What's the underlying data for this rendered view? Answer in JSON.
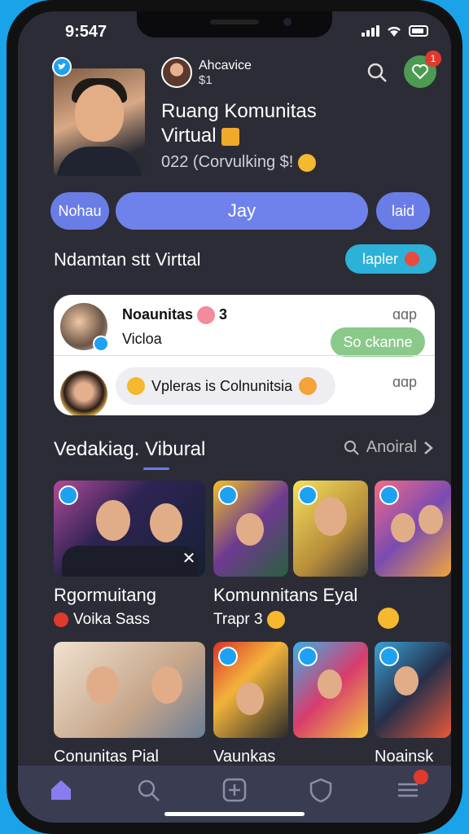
{
  "status": {
    "time": "9:547"
  },
  "header": {
    "owner_name": "Ahcavice",
    "owner_sub": "$1",
    "title_line1": "Ruang Komunitas",
    "title_line2": "Virtual",
    "meta": "022 (Corvulking $!"
  },
  "notifications": {
    "count": "1"
  },
  "tabs": [
    {
      "label": "Nohau"
    },
    {
      "label": "Jay"
    },
    {
      "label": "laid"
    }
  ],
  "section1": {
    "title": "Ndamtan stt Virttal",
    "pill_label": "lapler"
  },
  "chat_card": {
    "row1": {
      "name": "Noaunitas",
      "count": "3",
      "sub": "Vicloa",
      "meta": "ɑɑp",
      "button": "So ckanne"
    },
    "row2": {
      "message": "Vpleras is Colnunitsia",
      "meta": "ɑɑp"
    }
  },
  "section2": {
    "title": "Vedakiag. Vibural",
    "more_label": "Anoiral"
  },
  "tiles": {
    "label_a": "Rgormuitang",
    "sub_a": "Voika Sass",
    "label_b": "Komunnitans Eyal",
    "sub_b": "Trapr 3",
    "label_c": "Conunitas Pial",
    "label_d": "Vaunkas",
    "label_e": "Noainsk"
  },
  "colors": {
    "accent": "#6a7de6",
    "background": "#2b2c36",
    "pill": "#2cb1d8",
    "join": "#8bc98b",
    "badge": "#e0392d"
  },
  "icons": [
    "twitter-bird-icon",
    "search-icon",
    "heart-icon",
    "home-icon",
    "plus-icon",
    "shield-icon",
    "menu-icon",
    "chevron-right-icon"
  ]
}
